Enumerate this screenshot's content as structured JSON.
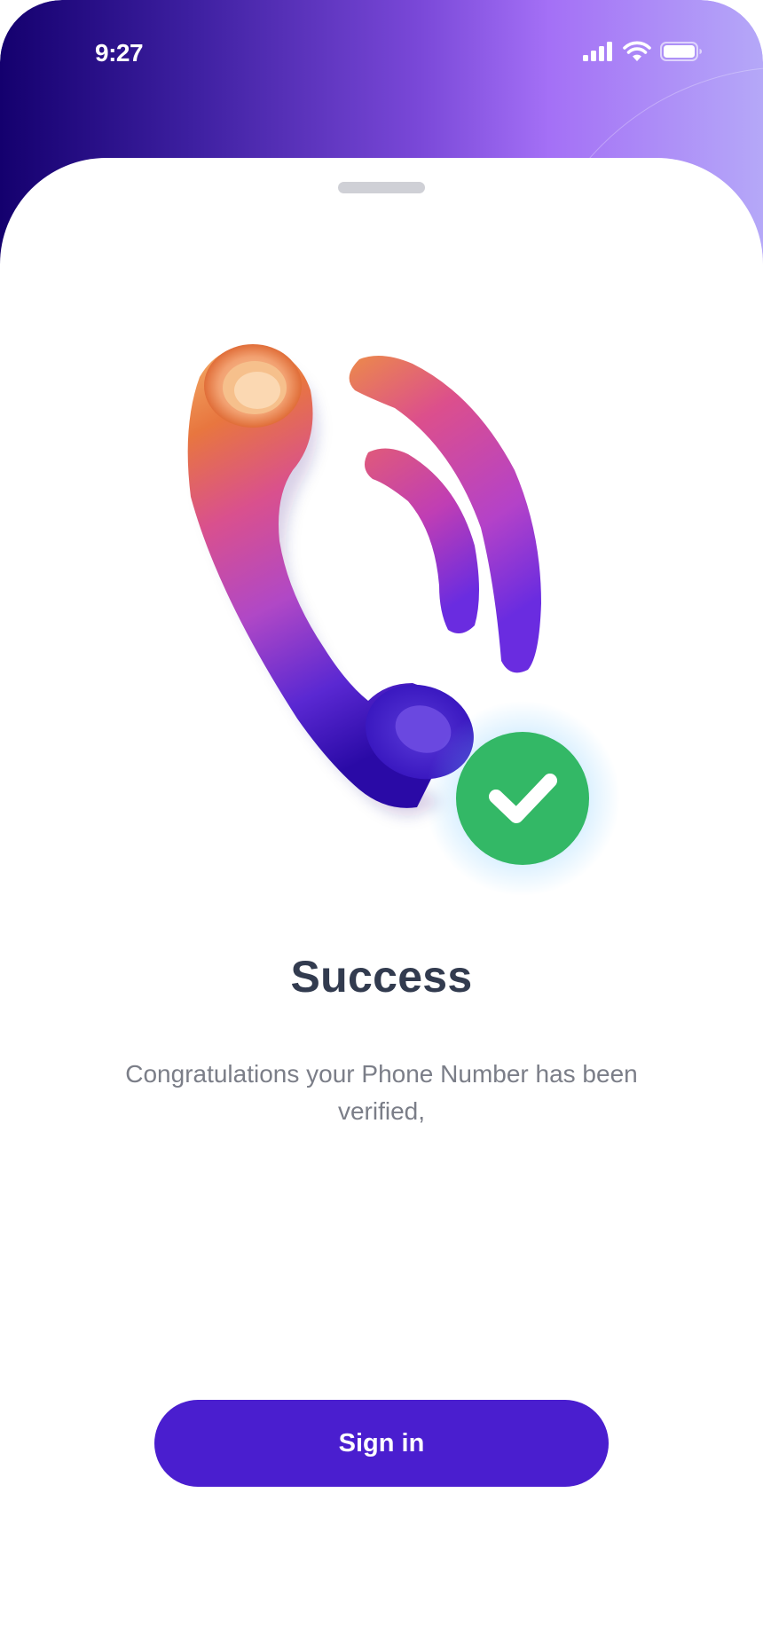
{
  "status_bar": {
    "time": "9:27",
    "icons": [
      "cellular-signal-icon",
      "wifi-icon",
      "battery-icon"
    ]
  },
  "illustration": {
    "icon": "phone-handset-icon",
    "badge_icon": "checkmark-icon",
    "badge_color": "#33b866"
  },
  "content": {
    "title": "Success",
    "message": "Congratulations your Phone Number has been verified,"
  },
  "actions": {
    "signin_label": "Sign in"
  },
  "colors": {
    "primary": "#4a1ecf",
    "header_gradient_start": "#14006e",
    "header_gradient_end": "#b5a8f8",
    "title": "#323b4f",
    "body_text": "#7b7e88",
    "success": "#33b866"
  }
}
